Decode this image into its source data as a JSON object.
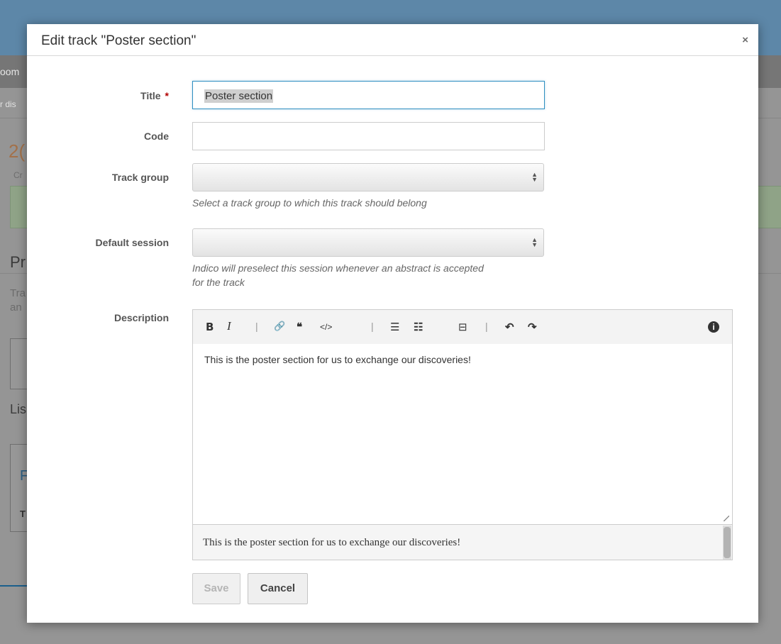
{
  "background": {
    "nav_text": "oom",
    "sub_text": "r dis",
    "year_partial": "2(",
    "created_partial": "Cr",
    "section_partial": "Pr",
    "desc_partial_1": "Tra",
    "desc_partial_2": "an",
    "list_partial": "Lis",
    "row_partial": "F",
    "row2_partial": "T"
  },
  "modal": {
    "title": "Edit track \"Poster section\"",
    "close_icon": "×"
  },
  "form": {
    "title_label": "Title",
    "required_mark": "*",
    "title_value": "Poster section",
    "code_label": "Code",
    "code_value": "",
    "track_group_label": "Track group",
    "track_group_value": "",
    "track_group_help": "Select a track group to which this track should belong",
    "default_session_label": "Default session",
    "default_session_value": "",
    "default_session_help_1": "Indico will preselect this session whenever an abstract is accepted",
    "default_session_help_2": "for the track",
    "description_label": "Description"
  },
  "editor": {
    "toolbar": {
      "bold": "B",
      "italic": "I",
      "sep": "|",
      "link": "🔗",
      "quote": "❝",
      "code": "</>",
      "ordered_list": "☰",
      "unordered_list": "☷",
      "hr": "⊟",
      "undo": "↶",
      "redo": "↷",
      "info": "ℹ"
    },
    "content": "This is the poster section for us to exchange our discoveries!",
    "preview": "This is the poster section for us to exchange our discoveries!"
  },
  "buttons": {
    "save": "Save",
    "cancel": "Cancel"
  }
}
